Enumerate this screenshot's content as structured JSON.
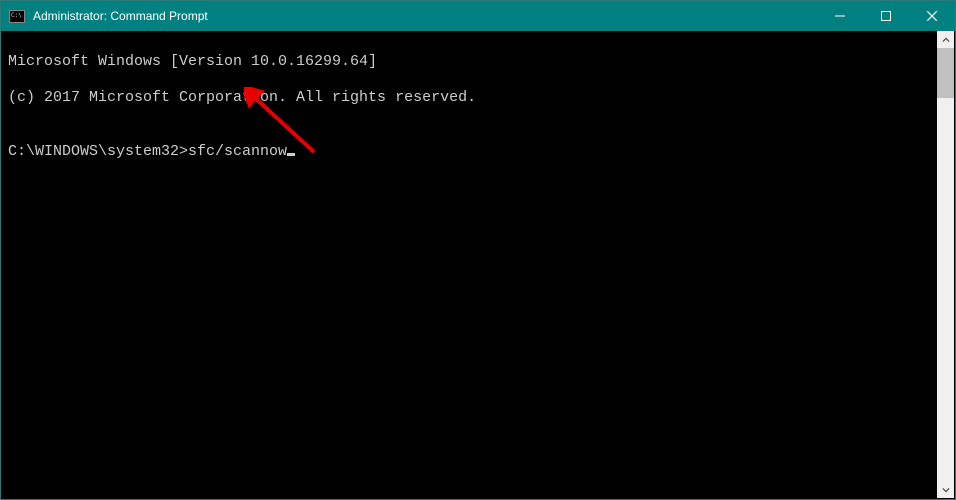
{
  "window": {
    "title": "Administrator: Command Prompt"
  },
  "terminal": {
    "line1": "Microsoft Windows [Version 10.0.16299.64]",
    "line2": "(c) 2017 Microsoft Corporation. All rights reserved.",
    "blank": "",
    "prompt": "C:\\WINDOWS\\system32>",
    "command": "sfc/scannow"
  },
  "annotation": {
    "arrow_color": "#e60000"
  }
}
